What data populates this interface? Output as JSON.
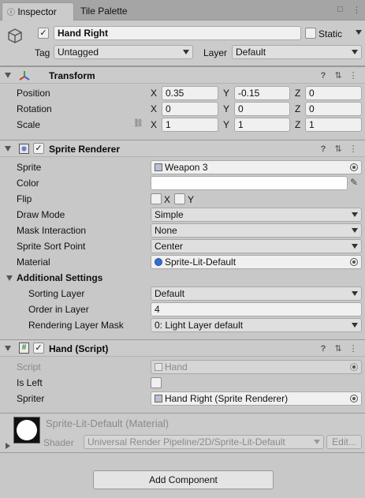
{
  "tabs": {
    "inspector": "Inspector",
    "tile_palette": "Tile Palette"
  },
  "header": {
    "name": "Hand Right",
    "active_checked": "✓",
    "static_label": "Static",
    "tag_label": "Tag",
    "tag_value": "Untagged",
    "layer_label": "Layer",
    "layer_value": "Default"
  },
  "transform": {
    "title": "Transform",
    "position_label": "Position",
    "rotation_label": "Rotation",
    "scale_label": "Scale",
    "position": {
      "x": "0.35",
      "y": "-0.15",
      "z": "0"
    },
    "rotation": {
      "x": "0",
      "y": "0",
      "z": "0"
    },
    "scale": {
      "x": "1",
      "y": "1",
      "z": "1"
    },
    "axis_x": "X",
    "axis_y": "Y",
    "axis_z": "Z"
  },
  "sprite_renderer": {
    "title": "Sprite Renderer",
    "enabled_check": "✓",
    "sprite_label": "Sprite",
    "sprite_value": "Weapon 3",
    "color_label": "Color",
    "flip_label": "Flip",
    "flip_x": "X",
    "flip_y": "Y",
    "draw_mode_label": "Draw Mode",
    "draw_mode_value": "Simple",
    "mask_label": "Mask Interaction",
    "mask_value": "None",
    "sort_point_label": "Sprite Sort Point",
    "sort_point_value": "Center",
    "material_label": "Material",
    "material_value": "Sprite-Lit-Default",
    "additional_label": "Additional Settings",
    "sorting_layer_label": "Sorting Layer",
    "sorting_layer_value": "Default",
    "order_label": "Order in Layer",
    "order_value": "4",
    "rendering_mask_label": "Rendering Layer Mask",
    "rendering_mask_value": "0: Light Layer default"
  },
  "hand_script": {
    "title": "Hand (Script)",
    "enabled_check": "✓",
    "script_label": "Script",
    "script_value": "Hand",
    "is_left_label": "Is Left",
    "spriter_label": "Spriter",
    "spriter_value": "Hand Right (Sprite Renderer)"
  },
  "material": {
    "name": "Sprite-Lit-Default (Material)",
    "shader_label": "Shader",
    "shader_value": "Universal Render Pipeline/2D/Sprite-Lit-Default",
    "edit_label": "Edit..."
  },
  "footer": {
    "add_component": "Add Component"
  },
  "icons": {
    "lock": "🔒",
    "menu": "⋮",
    "help": "?",
    "presets": "⇅",
    "unlink": "⛓"
  },
  "colors": {
    "panel": "#c8c8c8",
    "header": "#cbcbcb",
    "accent_blue": "#2f6fd1"
  }
}
